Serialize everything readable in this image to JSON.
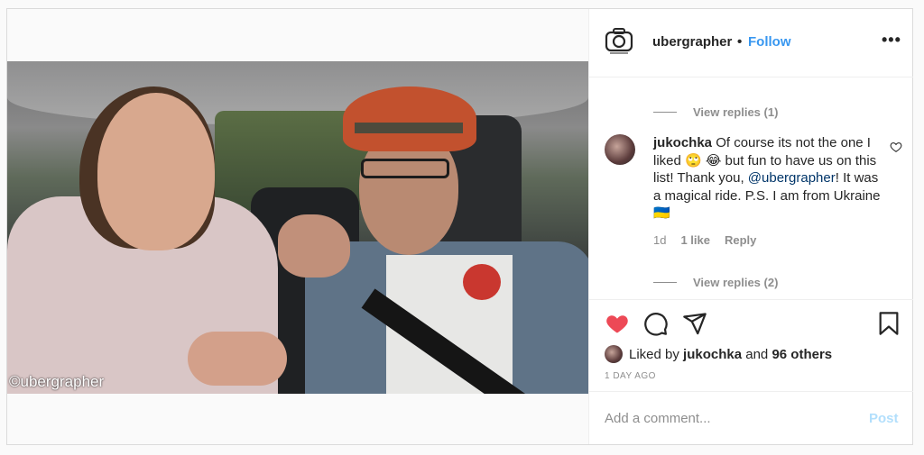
{
  "header": {
    "username": "ubergrapher",
    "separator": "•",
    "follow_label": "Follow",
    "more_label": "•••"
  },
  "photo": {
    "watermark": "©ubergrapher"
  },
  "comments": {
    "view_replies_1": "View replies (1)",
    "comment": {
      "username": "jukochka",
      "text_part1": "Of course its not the one I liked 🙄 😂  but fun to have us on this list! Thank you, ",
      "mention": "@ubergrapher",
      "text_part2": "! It was a magical ride. P.S. I am from Ukraine 🇺🇦",
      "age": "1d",
      "likes": "1 like",
      "reply_label": "Reply"
    },
    "view_replies_2": "View replies (2)"
  },
  "actions": {
    "liked_prefix": "Liked by ",
    "liked_user": "jukochka",
    "liked_and": " and ",
    "liked_others": "96 others",
    "time": "1 DAY AGO"
  },
  "add_comment": {
    "placeholder": "Add a comment...",
    "post_label": "Post"
  },
  "colors": {
    "accent": "#3897f0",
    "like_red": "#ed4956",
    "muted": "#8e8e8e",
    "mention": "#003569"
  },
  "icons": [
    "camera-icon",
    "more-icon",
    "heart-outline-icon",
    "heart-filled-icon",
    "comment-icon",
    "share-icon",
    "bookmark-icon"
  ]
}
